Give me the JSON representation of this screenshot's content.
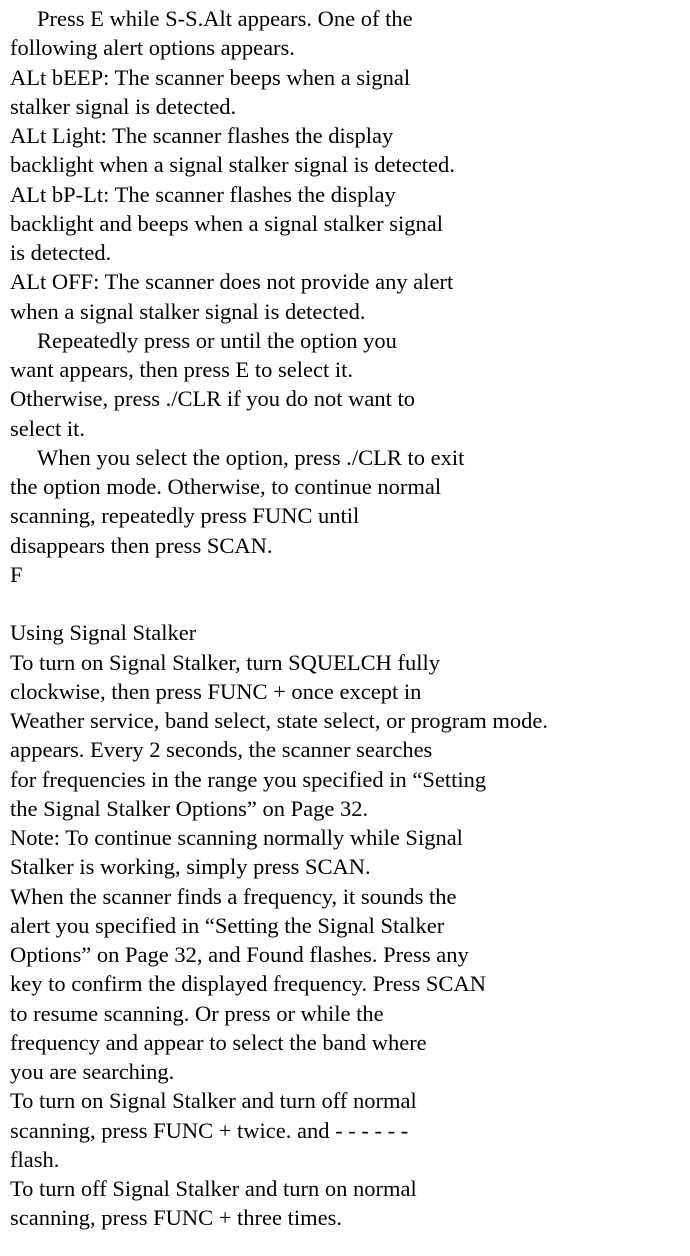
{
  "p1": {
    "l1": "Press E while S-S.Alt appears. One of the",
    "l2": "following alert options appears."
  },
  "p2": {
    "l1": "ALt bEEP: The scanner beeps when a signal",
    "l2": "stalker signal is detected."
  },
  "p3": {
    "l1": "ALt Light: The scanner flashes the display",
    "l2": "backlight when a signal stalker signal is detected."
  },
  "p4": {
    "l1": "ALt bP-Lt: The scanner flashes the display",
    "l2": "backlight and beeps when a signal stalker signal",
    "l3": "is detected."
  },
  "p5": {
    "l1": "ALt OFF: The scanner does not provide any alert",
    "l2": "when a signal stalker signal is detected."
  },
  "p6": {
    "l1": "Repeatedly press or until the option you",
    "l2": "want appears, then press E to select it.",
    "l3": "Otherwise, press ./CLR if you do not want to",
    "l4": "select it."
  },
  "p7": {
    "l1": "When you select the option, press ./CLR to exit",
    "l2": "the option mode. Otherwise, to continue normal",
    "l3": "scanning, repeatedly press FUNC until",
    "l4": "disappears then press SCAN."
  },
  "p8": {
    "l1": "F"
  },
  "heading": "Using Signal Stalker",
  "p9": {
    "l1": "To turn on Signal Stalker, turn SQUELCH fully",
    "l2": "clockwise, then press FUNC + once except in",
    "l3": "Weather service, band select, state select, or program mode.",
    "l4": "appears. Every 2 seconds, the scanner searches",
    "l5": "for frequencies in the range you specified in “Setting",
    "l6": "the Signal Stalker Options” on Page 32."
  },
  "p10": {
    "l1": "Note: To continue scanning normally while Signal",
    "l2": "Stalker is working, simply press SCAN."
  },
  "p11": {
    "l1": "When the scanner finds a frequency, it sounds the",
    "l2": "alert you specified in “Setting the Signal Stalker",
    "l3": "Options” on Page 32, and Found flashes. Press any",
    "l4": "key to confirm the displayed frequency. Press SCAN",
    "l5": "to resume scanning. Or press or while the",
    "l6": "frequency and appear to select the band where",
    "l7": "you are searching."
  },
  "p12": {
    "l1": "To turn on Signal Stalker and turn off normal",
    "l2": "scanning, press FUNC + twice. and - - - - - -",
    "l3": "flash."
  },
  "p13": {
    "l1": "To turn off Signal Stalker and turn on normal",
    "l2": "scanning, press FUNC + three times."
  }
}
